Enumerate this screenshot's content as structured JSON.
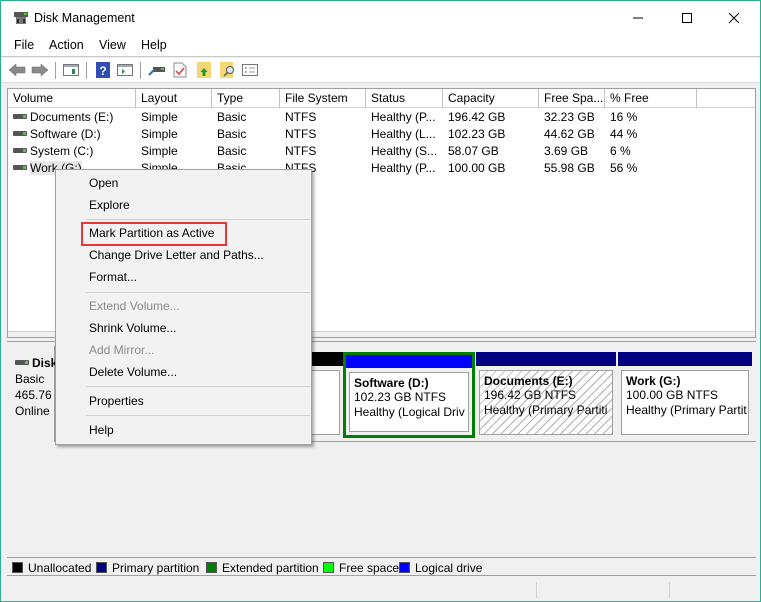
{
  "window": {
    "title": "Disk Management",
    "controls": {
      "minimize": "minimize",
      "maximize": "maximize",
      "close": "close"
    }
  },
  "menubar": {
    "items": [
      "File",
      "Action",
      "View",
      "Help"
    ]
  },
  "toolbar": {
    "buttons": [
      "back-icon",
      "forward-icon",
      "console-tree-icon",
      "help-icon",
      "action-pane-icon",
      "connect-drive-icon",
      "checklist-icon",
      "folder-up-icon",
      "folder-search-icon",
      "properties-list-icon"
    ]
  },
  "volume_list": {
    "columns": [
      "Volume",
      "Layout",
      "Type",
      "File System",
      "Status",
      "Capacity",
      "Free Spa...",
      "% Free"
    ],
    "rows": [
      {
        "volume": "Documents (E:)",
        "layout": "Simple",
        "type": "Basic",
        "fs": "NTFS",
        "status": "Healthy (P...",
        "capacity": "196.42 GB",
        "free": "32.23 GB",
        "pct": "16 %"
      },
      {
        "volume": "Software (D:)",
        "layout": "Simple",
        "type": "Basic",
        "fs": "NTFS",
        "status": "Healthy (L...",
        "capacity": "102.23 GB",
        "free": "44.62 GB",
        "pct": "44 %"
      },
      {
        "volume": "System (C:)",
        "layout": "Simple",
        "type": "Basic",
        "fs": "NTFS",
        "status": "Healthy (S...",
        "capacity": "58.07 GB",
        "free": "3.69 GB",
        "pct": "6 %"
      },
      {
        "volume": "Work (G:)",
        "layout": "Simple",
        "type": "Basic",
        "fs": "NTFS",
        "status": "Healthy (P...",
        "capacity": "100.00 GB",
        "free": "55.98 GB",
        "pct": "56 %"
      }
    ]
  },
  "disk": {
    "name": "Disk",
    "type": "Basic",
    "size": "465.76",
    "state": "Online",
    "partitions": [
      {
        "name": "Software  (D:)",
        "size": "102.23 GB NTFS",
        "status": "Healthy (Logical Driv",
        "bar_color": "#0000ff",
        "selected": true
      },
      {
        "name": "Documents  (E:)",
        "size": "196.42 GB NTFS",
        "status": "Healthy (Primary Partiti",
        "bar_color": "#000080",
        "hatched": true
      },
      {
        "name": "Work  (G:)",
        "size": "100.00 GB NTFS",
        "status": "Healthy (Primary Partit",
        "bar_color": "#000080"
      }
    ]
  },
  "legend": [
    {
      "label": "Unallocated",
      "color": "#000000"
    },
    {
      "label": "Primary partition",
      "color": "#000080"
    },
    {
      "label": "Extended partition",
      "color": "#008000"
    },
    {
      "label": "Free space",
      "color": "#00ff00"
    },
    {
      "label": "Logical drive",
      "color": "#0000ff"
    }
  ],
  "context_menu": {
    "items": [
      {
        "label": "Open",
        "enabled": true
      },
      {
        "label": "Explore",
        "enabled": true
      },
      {
        "label": "Mark Partition as Active",
        "enabled": true,
        "highlighted": true
      },
      {
        "label": "Change Drive Letter and Paths...",
        "enabled": true
      },
      {
        "label": "Format...",
        "enabled": true
      },
      {
        "label": "Extend Volume...",
        "enabled": false
      },
      {
        "label": "Shrink Volume...",
        "enabled": true
      },
      {
        "label": "Add Mirror...",
        "enabled": false
      },
      {
        "label": "Delete Volume...",
        "enabled": true
      },
      {
        "label": "Properties",
        "enabled": true
      },
      {
        "label": "Help",
        "enabled": true
      }
    ],
    "highlight_color": "#e53935"
  }
}
